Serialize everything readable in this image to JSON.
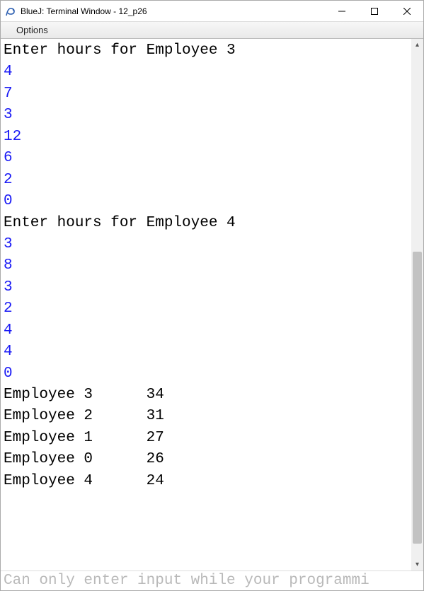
{
  "window": {
    "title": "BlueJ: Terminal Window - 12_p26"
  },
  "menubar": {
    "options": "Options"
  },
  "terminal": {
    "lines": [
      {
        "text": "Enter hours for Employee 3",
        "input": false
      },
      {
        "text": "4",
        "input": true
      },
      {
        "text": "7",
        "input": true
      },
      {
        "text": "3",
        "input": true
      },
      {
        "text": "12",
        "input": true
      },
      {
        "text": "6",
        "input": true
      },
      {
        "text": "2",
        "input": true
      },
      {
        "text": "0",
        "input": true
      },
      {
        "text": "Enter hours for Employee 4",
        "input": false
      },
      {
        "text": "3",
        "input": true
      },
      {
        "text": "8",
        "input": true
      },
      {
        "text": "3",
        "input": true
      },
      {
        "text": "2",
        "input": true
      },
      {
        "text": "4",
        "input": true
      },
      {
        "text": "4",
        "input": true
      },
      {
        "text": "0",
        "input": true
      },
      {
        "text": "Employee 3      34",
        "input": false
      },
      {
        "text": "Employee 2      31",
        "input": false
      },
      {
        "text": "Employee 1      27",
        "input": false
      },
      {
        "text": "Employee 0      26",
        "input": false
      },
      {
        "text": "Employee 4      24",
        "input": false
      }
    ]
  },
  "status": {
    "placeholder": "Can only enter input while your programmi"
  }
}
